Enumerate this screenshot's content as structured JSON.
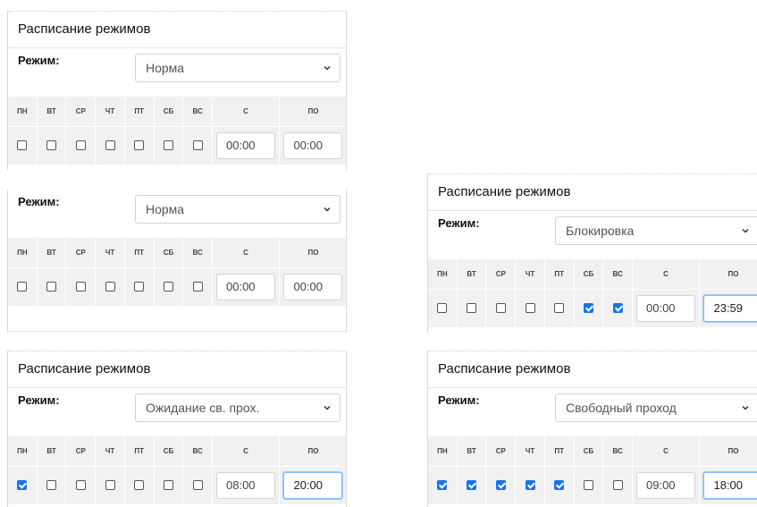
{
  "panels": [
    {
      "title": "Расписание режимов",
      "mode_label": "Режим:",
      "mode": "Норма",
      "days": [
        "ПН",
        "ВТ",
        "СР",
        "ЧТ",
        "ПТ",
        "СБ",
        "ВС"
      ],
      "from_label": "С",
      "to_label": "ПО",
      "checked": [
        false,
        false,
        false,
        false,
        false,
        false,
        false
      ],
      "from": "00:00",
      "to": "00:00"
    },
    {
      "title": "",
      "mode_label": "Режим:",
      "mode": "Норма",
      "days": [
        "ПН",
        "ВТ",
        "СР",
        "ЧТ",
        "ПТ",
        "СБ",
        "ВС"
      ],
      "from_label": "С",
      "to_label": "ПО",
      "checked": [
        false,
        false,
        false,
        false,
        false,
        false,
        false
      ],
      "from": "00:00",
      "to": "00:00"
    },
    {
      "title": "Расписание режимов",
      "mode_label": "Режим:",
      "mode": "Ожидание св. прох.",
      "days": [
        "ПН",
        "ВТ",
        "СР",
        "ЧТ",
        "ПТ",
        "СБ",
        "ВС"
      ],
      "from_label": "С",
      "to_label": "ПО",
      "checked": [
        true,
        false,
        false,
        false,
        false,
        false,
        false
      ],
      "from": "08:00",
      "to": "20:00"
    },
    {
      "title": "Расписание режимов",
      "mode_label": "Режим:",
      "mode": "Блокировка",
      "days": [
        "ПН",
        "ВТ",
        "СР",
        "ЧТ",
        "ПТ",
        "СБ",
        "ВС"
      ],
      "from_label": "С",
      "to_label": "ПО",
      "checked": [
        false,
        false,
        false,
        false,
        false,
        true,
        true
      ],
      "from": "00:00",
      "to": "23:59"
    },
    {
      "title": "Расписание режимов",
      "mode_label": "Режим:",
      "mode": "Свободный проход",
      "days": [
        "ПН",
        "ВТ",
        "СР",
        "ЧТ",
        "ПТ",
        "СБ",
        "ВС"
      ],
      "from_label": "С",
      "to_label": "ПО",
      "checked": [
        true,
        true,
        true,
        true,
        true,
        false,
        false
      ],
      "from": "09:00",
      "to": "18:00"
    }
  ],
  "icons": {
    "select_arrow": "chevron-down-icon",
    "checkbox_checked_color": "#1a73e8"
  }
}
